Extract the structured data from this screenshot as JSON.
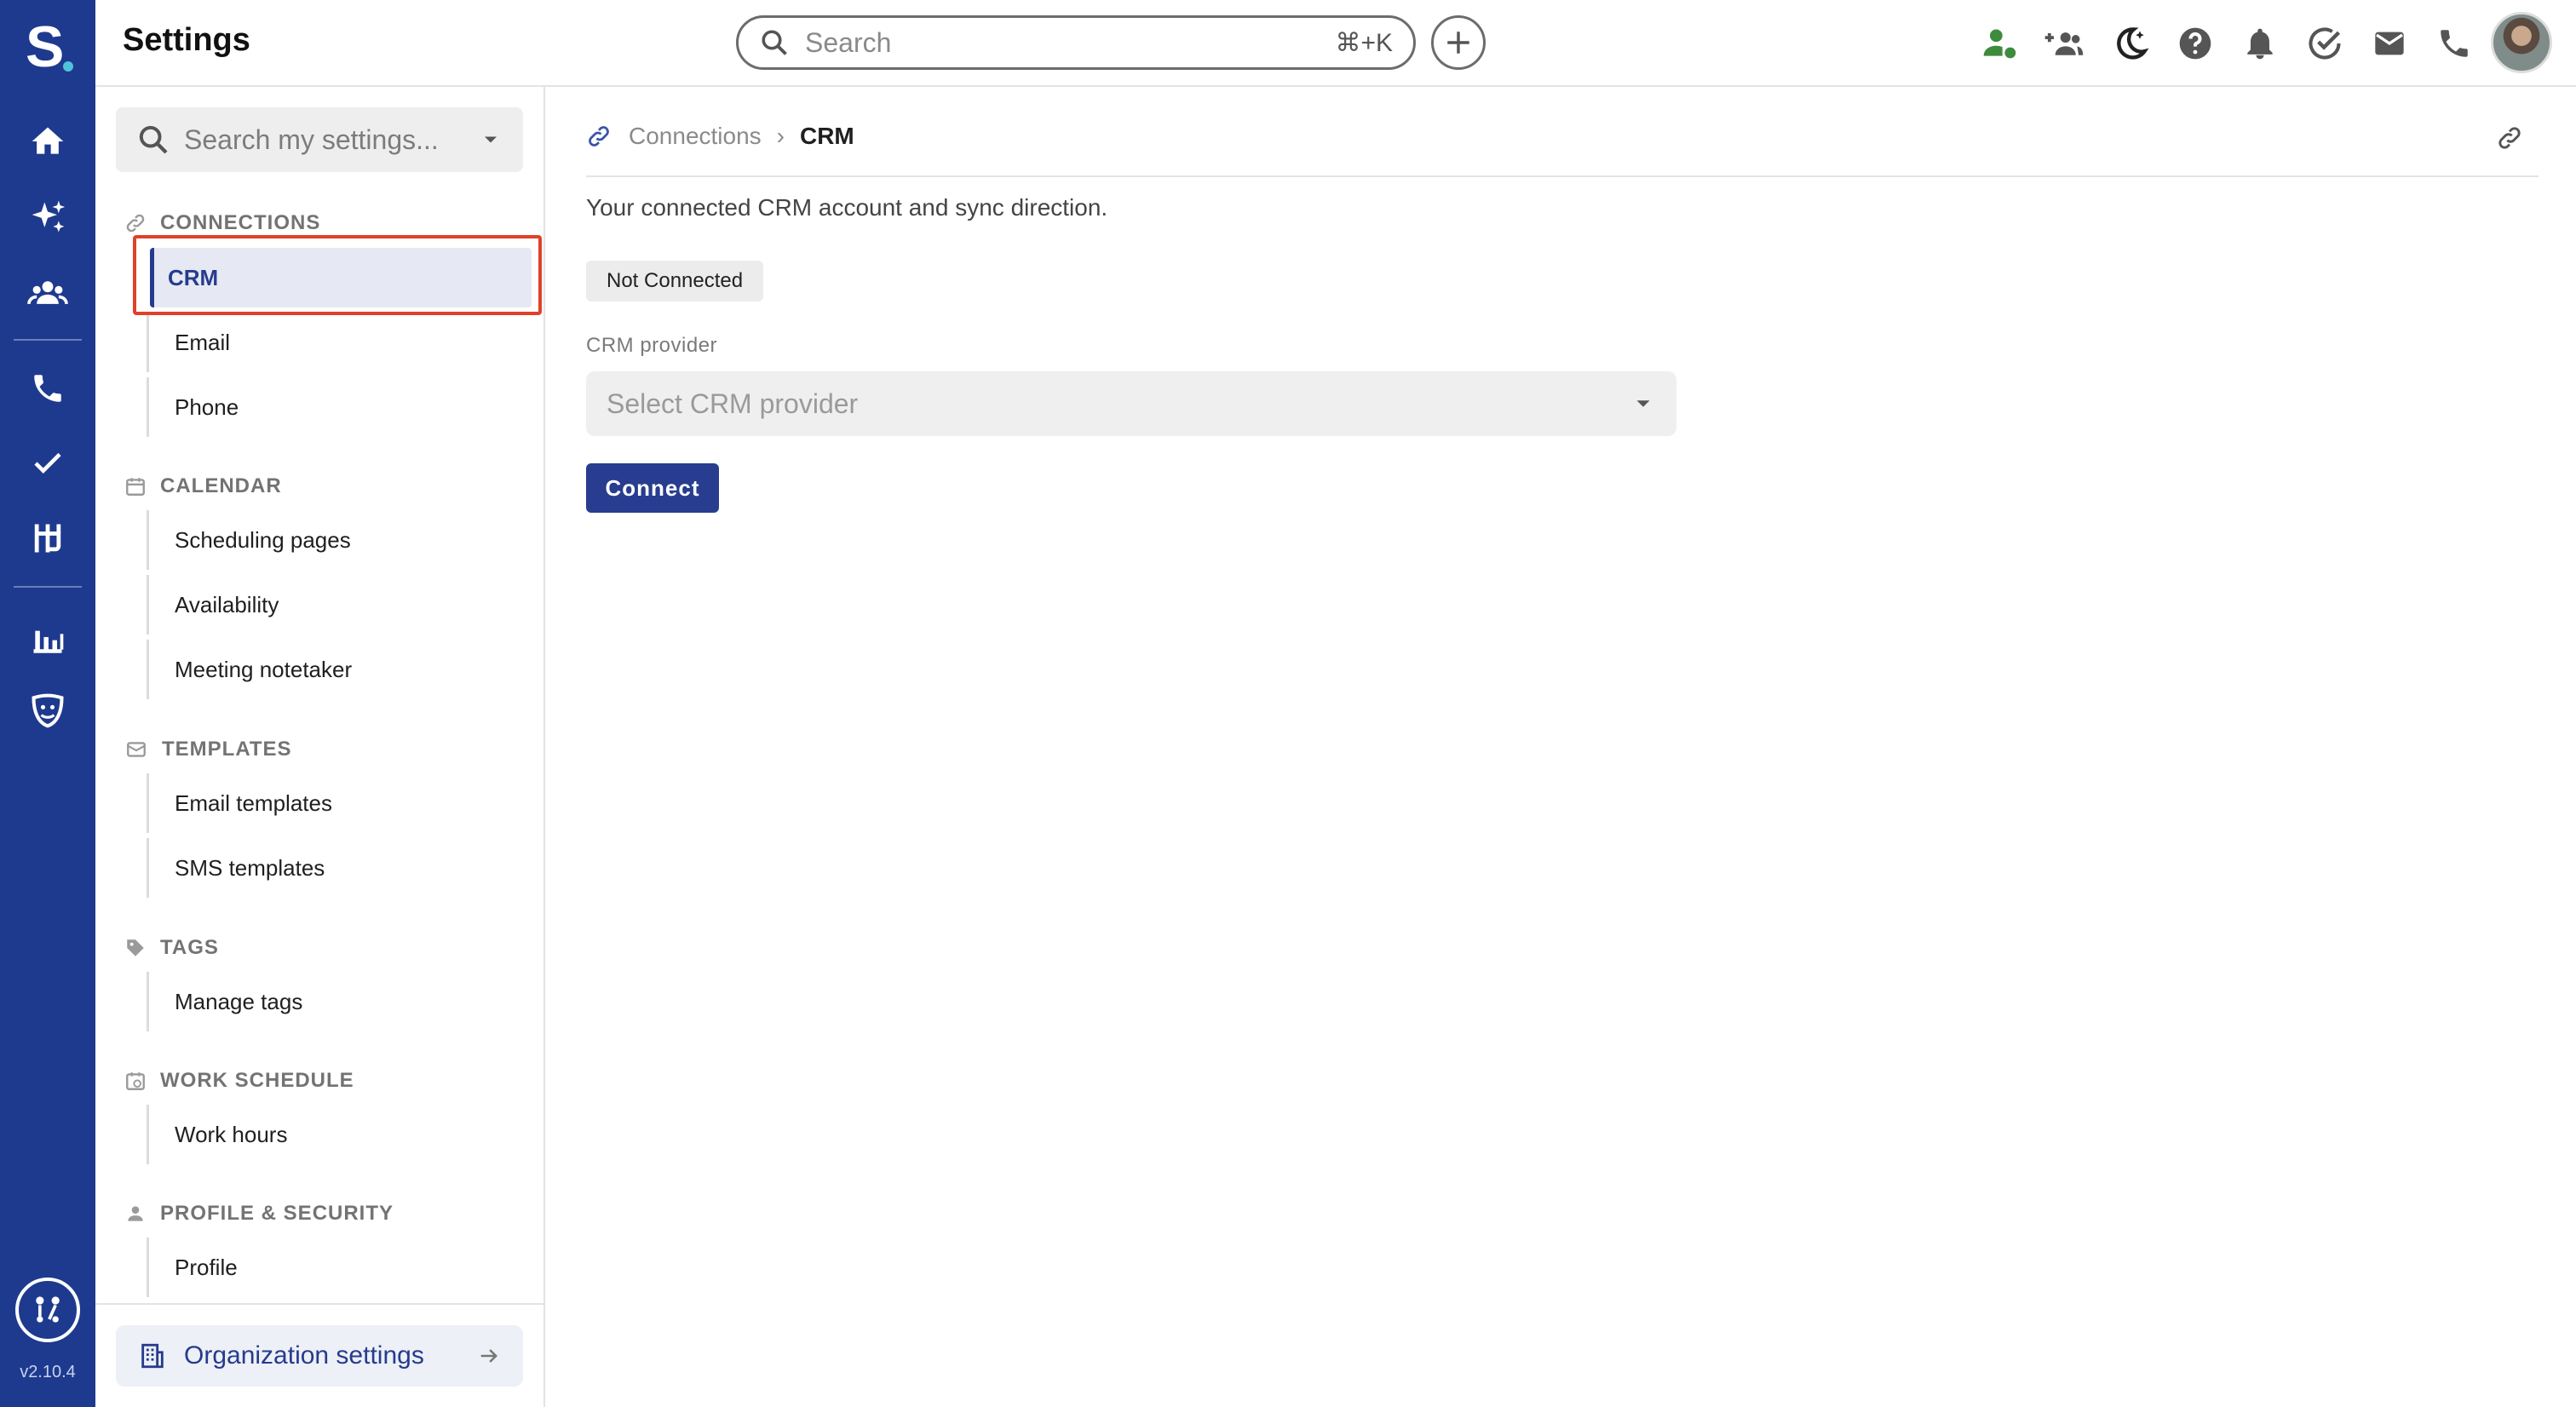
{
  "app": {
    "title": "Settings",
    "version": "v2.10.4",
    "brand_color": "#1e3a8f"
  },
  "search": {
    "placeholder": "Search",
    "shortcut": "⌘+K"
  },
  "sidebar": {
    "search_placeholder": "Search my settings...",
    "sections": [
      {
        "label": "CONNECTIONS",
        "items": [
          "CRM",
          "Email",
          "Phone"
        ]
      },
      {
        "label": "CALENDAR",
        "items": [
          "Scheduling pages",
          "Availability",
          "Meeting notetaker"
        ]
      },
      {
        "label": "TEMPLATES",
        "items": [
          "Email templates",
          "SMS templates"
        ]
      },
      {
        "label": "TAGS",
        "items": [
          "Manage tags"
        ]
      },
      {
        "label": "WORK SCHEDULE",
        "items": [
          "Work hours"
        ]
      },
      {
        "label": "PROFILE & SECURITY",
        "items": [
          "Profile"
        ]
      }
    ],
    "active_item": "CRM",
    "org_settings_label": "Organization settings"
  },
  "main": {
    "breadcrumb": {
      "parent": "Connections",
      "current": "CRM"
    },
    "description": "Your connected CRM account and sync direction.",
    "status_badge": "Not Connected",
    "crm_provider_label": "CRM provider",
    "crm_provider_placeholder": "Select CRM provider",
    "connect_label": "Connect"
  }
}
